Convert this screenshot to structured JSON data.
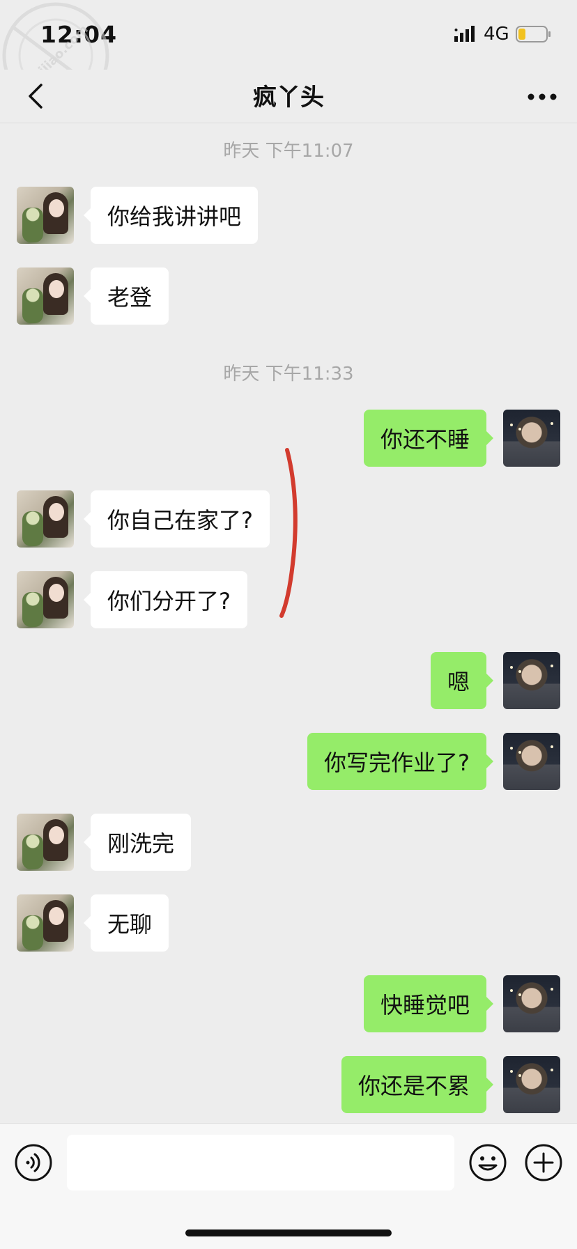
{
  "status_bar": {
    "time": "12:04",
    "network": "4G",
    "signal_icon": "signal-bars-icon",
    "battery_icon": "battery-low-icon"
  },
  "header": {
    "title": "疯丫头",
    "back_icon": "chevron-left-icon",
    "more_icon": "more-dots-icon"
  },
  "watermark": {
    "text": "haijiao.com"
  },
  "timestamps": [
    "昨天 下午11:07",
    "昨天 下午11:33"
  ],
  "messages": [
    {
      "side": "left",
      "text": "你给我讲讲吧"
    },
    {
      "side": "left",
      "text": "老登"
    },
    {
      "side": "right",
      "text": "你还不睡"
    },
    {
      "side": "left",
      "text": "你自己在家了?"
    },
    {
      "side": "left",
      "text": "你们分开了?"
    },
    {
      "side": "right",
      "text": "嗯"
    },
    {
      "side": "right",
      "text": "你写完作业了?"
    },
    {
      "side": "left",
      "text": "刚洗完"
    },
    {
      "side": "left",
      "text": "无聊"
    },
    {
      "side": "right",
      "text": "快睡觉吧"
    },
    {
      "side": "right",
      "text": "你还是不累"
    }
  ],
  "input_bar": {
    "value": "",
    "voice_icon": "voice-icon",
    "emoji_icon": "emoji-icon",
    "plus_icon": "plus-icon"
  },
  "colors": {
    "background": "#ededed",
    "bubble_sent": "#95ec69",
    "bubble_received": "#ffffff",
    "annotation": "#d23b2e"
  }
}
